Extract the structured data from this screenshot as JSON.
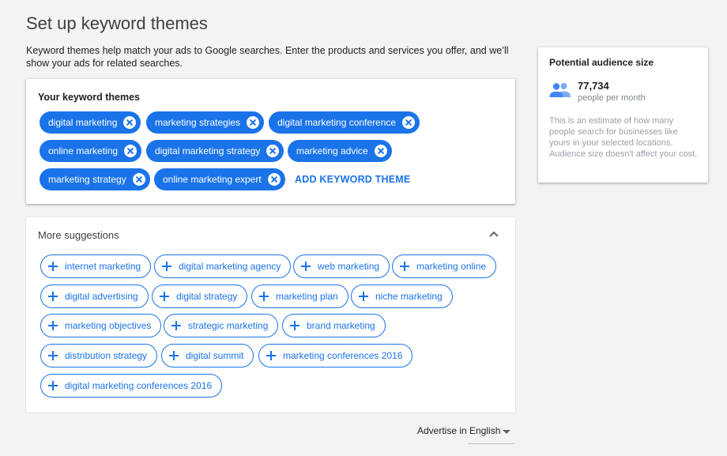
{
  "page": {
    "title": "Set up keyword themes",
    "description": "Keyword themes help match your ads to Google searches. Enter the products and services you offer, and we’ll show your ads for related searches."
  },
  "themes": {
    "title": "Your keyword themes",
    "chips": [
      "digital marketing",
      "marketing strategies",
      "digital marketing conference",
      "online marketing",
      "digital marketing strategy",
      "marketing advice",
      "marketing strategy",
      "online marketing expert"
    ],
    "add_label": "ADD KEYWORD THEME"
  },
  "suggestions": {
    "title": "More suggestions",
    "chips": [
      "internet marketing",
      "digital marketing agency",
      "web marketing",
      "marketing online",
      "digital advertising",
      "digital strategy",
      "marketing plan",
      "niche marketing",
      "marketing objectives",
      "strategic marketing",
      "brand marketing",
      "distribution strategy",
      "digital summit",
      "marketing conferences 2016",
      "digital marketing conferences 2016"
    ]
  },
  "language": {
    "value": "Advertise in English"
  },
  "audience": {
    "title": "Potential audience size",
    "value": "77,734",
    "unit": "people per month",
    "note": "This is an estimate of how many people search for businesses like yours in your selected locations. Audience size doesn't affect your cost."
  },
  "colors": {
    "accent": "#1a73e8",
    "background": "#f1f3f4",
    "muted": "#9aa0a6"
  },
  "icons": {
    "remove": "close-circle-icon",
    "add": "plus-icon",
    "collapse": "chevron-up-icon",
    "audience": "people-icon",
    "dropdown": "caret-down-icon"
  }
}
